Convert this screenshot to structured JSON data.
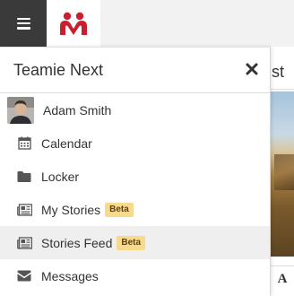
{
  "app": {
    "brand_color": "#c8202f"
  },
  "topbar": {
    "menu_icon": "hamburger-icon",
    "logo_icon": "teamie-logo-icon"
  },
  "drawer": {
    "title": "Teamie Next",
    "close_icon": "close-icon",
    "items": [
      {
        "label": "Adam Smith",
        "icon": "avatar"
      },
      {
        "label": "Calendar",
        "icon": "calendar-icon"
      },
      {
        "label": "Locker",
        "icon": "folder-icon"
      },
      {
        "label": "My Stories",
        "icon": "newspaper-icon",
        "badge": "Beta"
      },
      {
        "label": "Stories Feed",
        "icon": "newspaper-icon",
        "badge": "Beta",
        "active": true
      },
      {
        "label": "Messages",
        "icon": "envelope-icon"
      }
    ]
  },
  "background": {
    "heading_fragment": "st",
    "toolbar_glyph": "A"
  }
}
